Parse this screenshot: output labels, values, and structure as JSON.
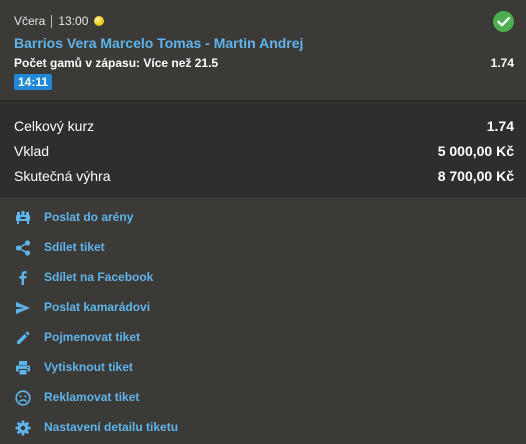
{
  "ticket": {
    "day": "Včera",
    "time": "13:00",
    "match": "Barrios Vera Marcelo Tomas - Martin Andrej",
    "market": "Počet gamů v zápasu: Více než 21.5",
    "odd": "1.74",
    "live_time": "14:11",
    "status_icon": "check-circle-icon",
    "sport_icon": "tennis-ball-icon"
  },
  "summary": {
    "total_odds_label": "Celkový kurz",
    "total_odds_value": "1.74",
    "stake_label": "Vklad",
    "stake_value": "5 000,00 Kč",
    "win_label": "Skutečná výhra",
    "win_value": "8 700,00 Kč"
  },
  "actions": [
    {
      "label": "Poslat do arény",
      "icon": "arena-icon"
    },
    {
      "label": "Sdílet tiket",
      "icon": "share-icon"
    },
    {
      "label": "Sdílet na Facebook",
      "icon": "facebook-icon"
    },
    {
      "label": "Poslat kamarádovi",
      "icon": "send-icon"
    },
    {
      "label": "Pojmenovat tiket",
      "icon": "pencil-icon"
    },
    {
      "label": "Vytisknout tiket",
      "icon": "printer-icon"
    },
    {
      "label": "Reklamovat tiket",
      "icon": "sad-face-icon"
    },
    {
      "label": "Nastavení detailu tiketu",
      "icon": "gear-icon"
    }
  ],
  "colors": {
    "link": "#5fb4ec",
    "success": "#4cae50",
    "badge": "#1e88d6",
    "background": "#3c3a37",
    "summary_background": "#2f2e2c"
  }
}
